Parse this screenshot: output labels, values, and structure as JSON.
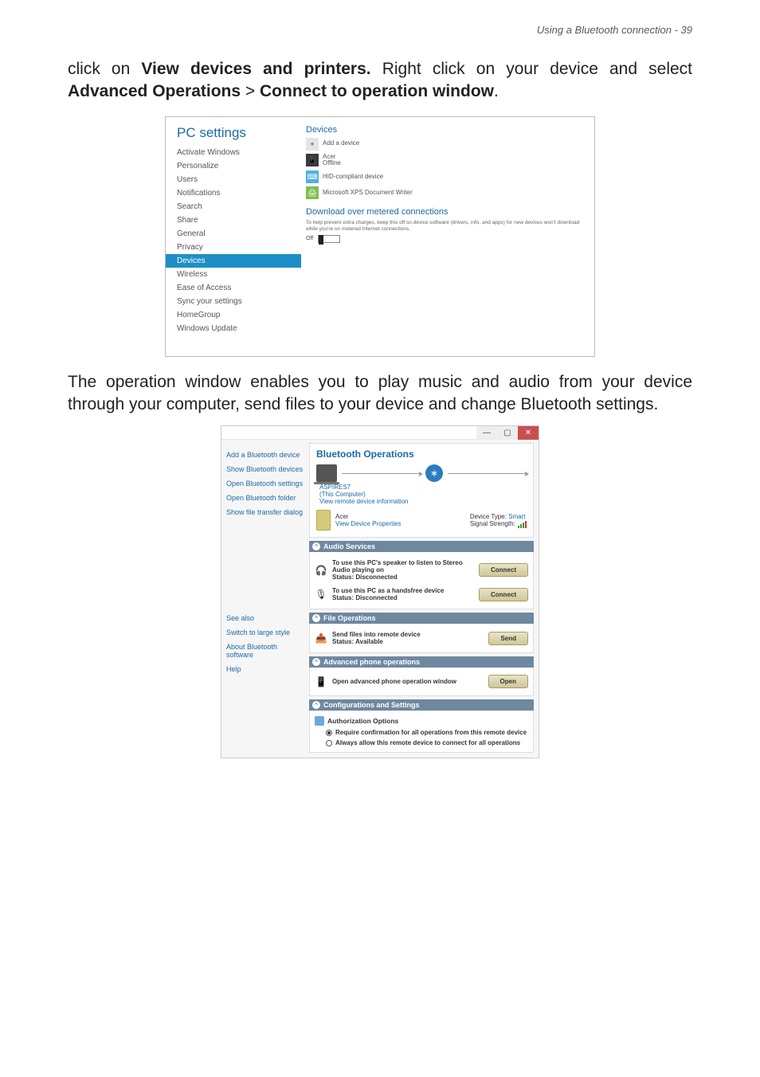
{
  "header": "Using a Bluetooth connection - 39",
  "para1_pre": "click on ",
  "para1_bold1": "View devices and printers.",
  "para1_mid": " Right click on your device and select ",
  "para1_bold2": "Advanced Operations",
  "para1_gt": " > ",
  "para1_bold3": "Connect to operation window",
  "para1_end": ".",
  "para2": "The operation window enables you to play music and audio from your device through your computer, send files to your device and change Bluetooth settings.",
  "shot1": {
    "title": "PC settings",
    "items": [
      "Activate Windows",
      "Personalize",
      "Users",
      "Notifications",
      "Search",
      "Share",
      "General",
      "Privacy",
      "Devices",
      "Wireless",
      "Ease of Access",
      "Sync your settings",
      "HomeGroup",
      "Windows Update"
    ],
    "selected_index": 8,
    "main": {
      "devices_title": "Devices",
      "add_device": "Add a device",
      "dev1_name": "Acer",
      "dev1_sub": "Offline",
      "dev2": "HID-compliant device",
      "dev3": "Microsoft XPS Document Writer",
      "metered_title": "Download over metered connections",
      "metered_desc": "To help prevent extra charges, keep this off so device software (drivers, info, and apps) for new devices won't download while you're on metered Internet connections.",
      "toggle_label": "Off"
    }
  },
  "shot2": {
    "titlebar": {
      "min": "—",
      "max": "▢",
      "close": "✕"
    },
    "left": {
      "links": [
        "Add a Bluetooth device",
        "Show Bluetooth devices",
        "Open Bluetooth settings",
        "Open Bluetooth folder",
        "Show file transfer dialog"
      ],
      "see_also": "See also",
      "bottom": [
        "Switch to large style",
        "About Bluetooth software",
        "Help"
      ]
    },
    "panel": {
      "heading": "Bluetooth Operations",
      "computer_name": "ASPIRES7",
      "computer_sub": "(This Computer)",
      "remote_info_link": "View remote device information",
      "device_name": "Acer",
      "view_props": "View Device Properties",
      "type_label": "Device Type:",
      "type_value": "Smart",
      "signal_label": "Signal Strength:"
    },
    "sections": {
      "audio": {
        "title": "Audio Services",
        "svc1_text": "To use this PC's speaker to listen to Stereo Audio playing on",
        "svc1_status": "Status:  Disconnected",
        "svc1_btn": "Connect",
        "svc2_text": "To use this PC as a handsfree device",
        "svc2_status": "Status:  Disconnected",
        "svc2_btn": "Connect"
      },
      "file": {
        "title": "File Operations",
        "svc_text": "Send files into remote device",
        "svc_status": "Status:  Available",
        "svc_btn": "Send"
      },
      "phone": {
        "title": "Advanced phone operations",
        "svc_text": "Open advanced phone operation window",
        "svc_btn": "Open"
      },
      "config": {
        "title": "Configurations and Settings",
        "auth_title": "Authorization Options",
        "opt1": "Require confirmation for all operations from this remote device",
        "opt2": "Always allow this remote device to connect for all operations"
      }
    }
  }
}
